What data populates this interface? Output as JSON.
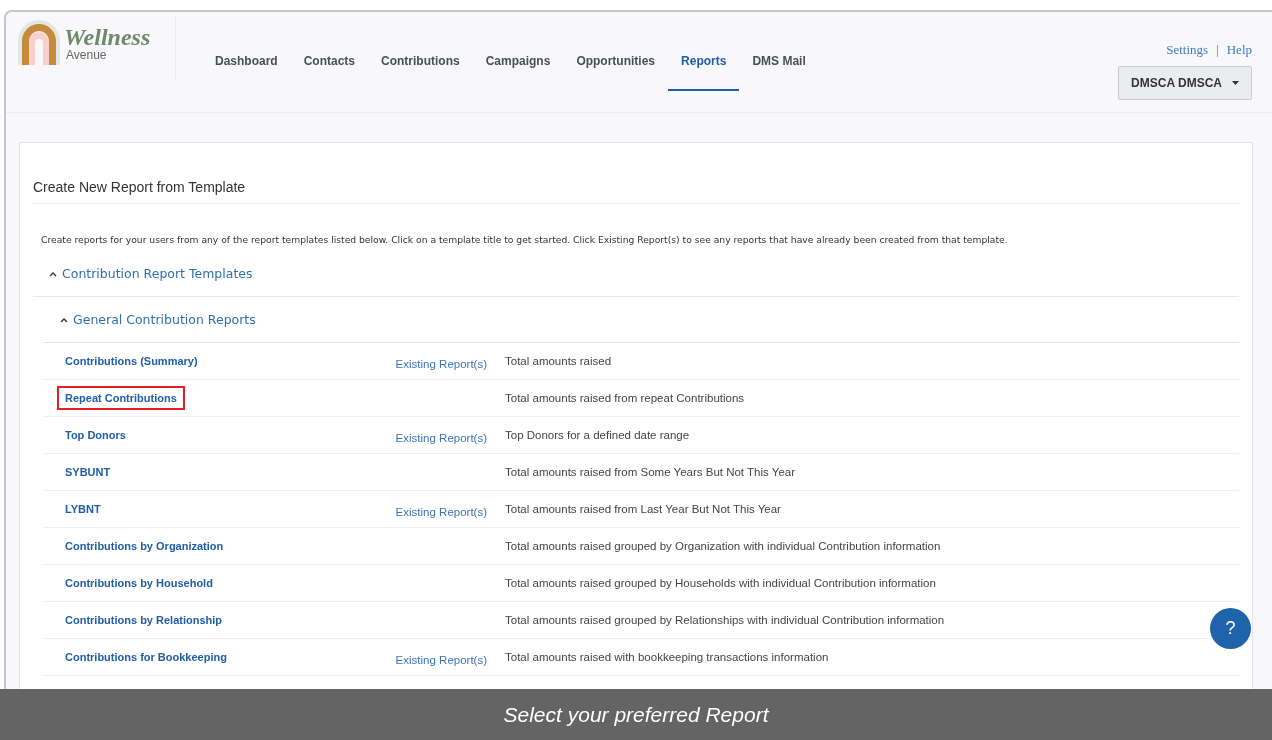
{
  "logo": {
    "title": "Wellness",
    "subtitle": "Avenue"
  },
  "nav": [
    {
      "label": "Dashboard",
      "selected": false
    },
    {
      "label": "Contacts",
      "selected": false
    },
    {
      "label": "Contributions",
      "selected": false
    },
    {
      "label": "Campaigns",
      "selected": false
    },
    {
      "label": "Opportunities",
      "selected": false
    },
    {
      "label": "Reports",
      "selected": true
    },
    {
      "label": "DMS Mail",
      "selected": false
    }
  ],
  "top_links": [
    "Settings",
    "|",
    "Help"
  ],
  "user_menu": {
    "label": "DMSCA DMSCA"
  },
  "card": {
    "title": "Create New Report from Template",
    "intro": "Create reports for your users from any of the report templates listed below. Click on a template title to get started. Click Existing Report(s) to see any reports that have already been created from that template.",
    "section": {
      "label": "Contribution Report Templates",
      "expanded": true,
      "subsection": {
        "label": "General Contribution Reports",
        "expanded": true,
        "rows": [
          {
            "name": "Contributions (Summary)",
            "existing": "Existing Report(s)",
            "description": "Total amounts raised",
            "highlighted": false
          },
          {
            "name": "Repeat Contributions",
            "description": "Total amounts raised from repeat Contributions",
            "highlighted": true
          },
          {
            "name": "Top Donors",
            "existing": "Existing Report(s)",
            "description": "Top Donors for a defined date range",
            "highlighted": false
          },
          {
            "name": "SYBUNT",
            "description": "Total amounts raised from Some Years But Not This Year",
            "highlighted": false
          },
          {
            "name": "LYBNT",
            "existing": "Existing Report(s)",
            "description": "Total amounts raised from Last Year But Not This Year",
            "highlighted": false
          },
          {
            "name": "Contributions by Organization",
            "description": "Total amounts raised grouped by Organization with individual Contribution information",
            "highlighted": false
          },
          {
            "name": "Contributions by Household",
            "description": "Total amounts raised grouped by Households with individual Contribution information",
            "highlighted": false
          },
          {
            "name": "Contributions by Relationship",
            "description": "Total amounts raised grouped by Relationships with individual Contribution information",
            "highlighted": false
          },
          {
            "name": "Contributions for Bookkeeping",
            "existing": "Existing Report(s)",
            "description": "Total amounts raised with bookkeeping transactions information",
            "highlighted": false
          }
        ]
      }
    }
  },
  "help_button": "?",
  "caption": "Select your preferred Report"
}
